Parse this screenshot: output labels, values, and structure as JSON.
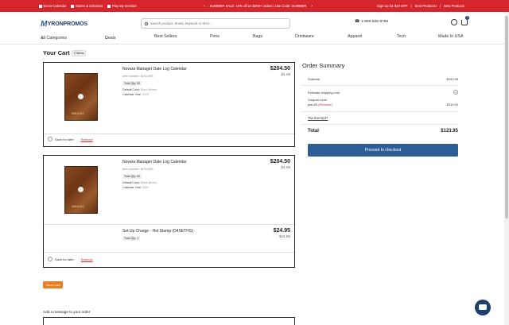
{
  "topbar": {
    "left_items": [
      "Event Calendar",
      "Stores & Solutions",
      "Play My Investor"
    ],
    "promo": "SUMMER SALE: 10% off on $200+ orders | Use Code: SUMMER",
    "right_items": [
      "Sign Up for $10 OFF",
      "Best Products!",
      "New Products"
    ]
  },
  "header": {
    "logo": {
      "mark": "M",
      "text": "YRONPROMOS"
    },
    "search_placeholder": "Search product, brand, keyword or SKU...",
    "phone": "1-800-526-9766",
    "cart_count": "2"
  },
  "nav": {
    "items": [
      "All Categories",
      "Deals",
      "Best Sellers",
      "Pens",
      "Bags",
      "Drinkware",
      "Apparel",
      "Tech",
      "Made In USA"
    ]
  },
  "cart": {
    "title": "Your Cart",
    "items_badge": "2 Items",
    "items": [
      {
        "name": "Novara Manager Date Log Calendar",
        "item_number": "Item Number: NOV1805",
        "qty": "Total Qty: 50",
        "details": [
          {
            "k": "Default Color:",
            "v": "Black Brown"
          },
          {
            "k": "Calendar Year:",
            "v": "2025"
          }
        ],
        "price": "$204.50",
        "unit_price": "$4.09",
        "save_label": "Save for later",
        "remove_label": "Remove"
      },
      {
        "name": "Novara Manager Date Log Calendar",
        "item_number": "Item Number: NOV1805",
        "qty": "Total Qty: 50",
        "details": [
          {
            "k": "Default Color:",
            "v": "Black Brown"
          },
          {
            "k": "Calendar Year:",
            "v": "2025"
          }
        ],
        "price": "$204.50",
        "unit_price": "$4.09",
        "setup": {
          "name": "Set Up Charge - Hot Stamp (D4SETHS)",
          "qty": "Total Qty: 1",
          "price": "$24.95",
          "unit_price": "$24.95"
        },
        "save_label": "Save for later",
        "remove_label": "Remove"
      }
    ],
    "clear_label": "Clear Cart",
    "message_label": "Add a message to your order"
  },
  "summary": {
    "title": "Order Summary",
    "subtotal_label": "Subtotal",
    "subtotal": "$433.95",
    "shipping_label": "Estimate shipping cost",
    "coupon_label": "Coupon code",
    "coupon_code": "plan25",
    "coupon_remove": "(Remove)",
    "coupon_value": "-$310.00",
    "tax_label": "Tax Exempt?",
    "total_label": "Total",
    "total": "$123.95",
    "checkout_label": "Proceed to checkout"
  },
  "book_stamp": "WEAGO",
  "colors": {
    "brand_red": "#d5262d",
    "brand_blue": "#2d5d97",
    "accent_orange": "#e67e22"
  }
}
